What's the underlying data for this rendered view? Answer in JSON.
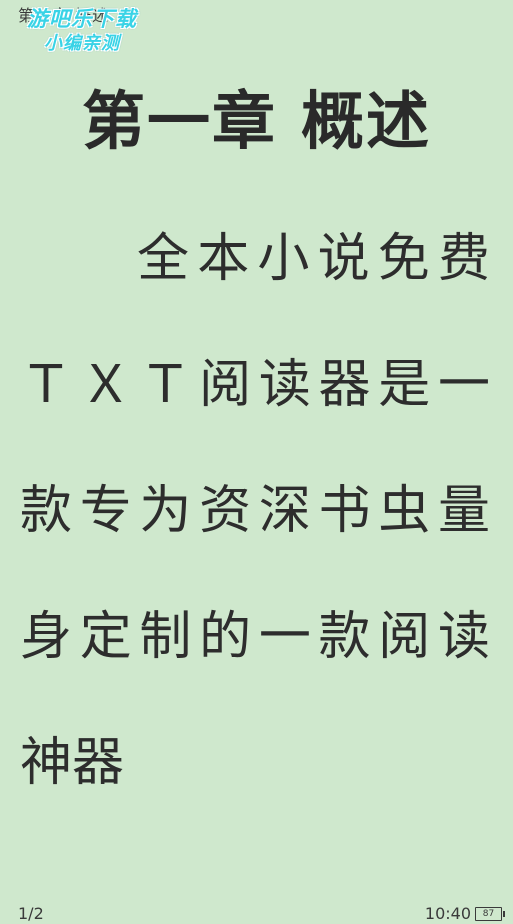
{
  "header": {
    "title": "第一章 概述"
  },
  "watermark": {
    "line1": "游吧乐下载",
    "line2": "小编亲测"
  },
  "chapter": {
    "heading": "第一章 概述",
    "lines": [
      "全本小说免费",
      "ＴＸＴ阅读器是一",
      "款专为资深书虫量",
      "身定制的一款阅读",
      "神器"
    ]
  },
  "footer": {
    "page_indicator": "1/2",
    "time": "10:40",
    "battery_level": "87"
  },
  "colors": {
    "background": "#cfe8cd",
    "text": "#2d2d2d",
    "watermark": "#39d3e6"
  }
}
